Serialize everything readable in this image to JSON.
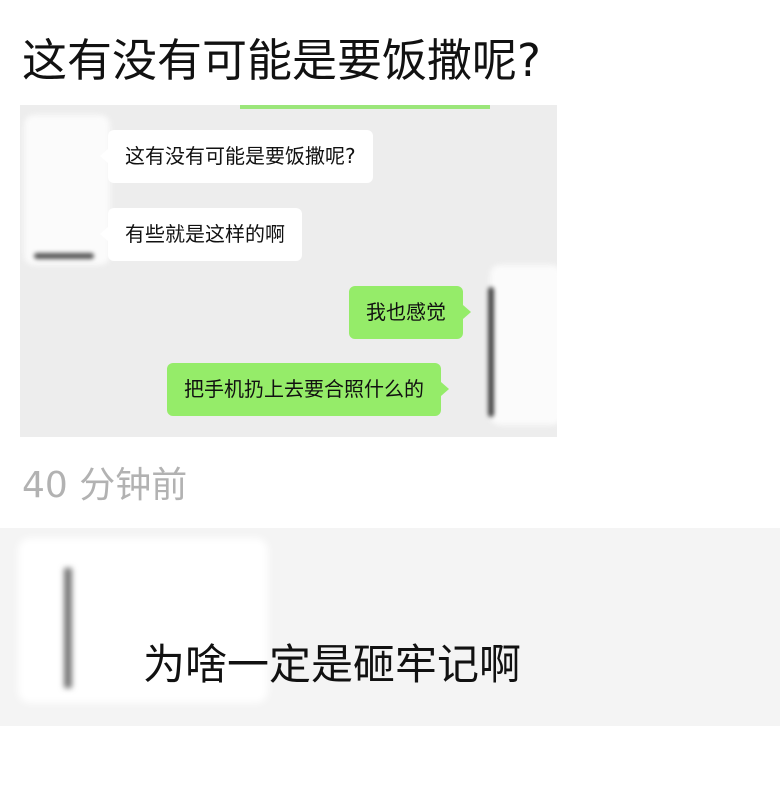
{
  "post": {
    "title": "这有没有可能是要饭撒呢?",
    "timestamp": "40 分钟前"
  },
  "screenshot": {
    "messages": [
      {
        "side": "left",
        "text": "这有没有可能是要饭撒呢?"
      },
      {
        "side": "left",
        "text": "有些就是这样的啊"
      },
      {
        "side": "right",
        "text": "我也感觉"
      },
      {
        "side": "right",
        "text": "把手机扔上去要合照什么的"
      }
    ],
    "colors": {
      "background": "#ededed",
      "incoming": "#ffffff",
      "outgoing": "#95ec69"
    }
  },
  "comment": {
    "text": "为啥一定是砸牢记啊"
  }
}
